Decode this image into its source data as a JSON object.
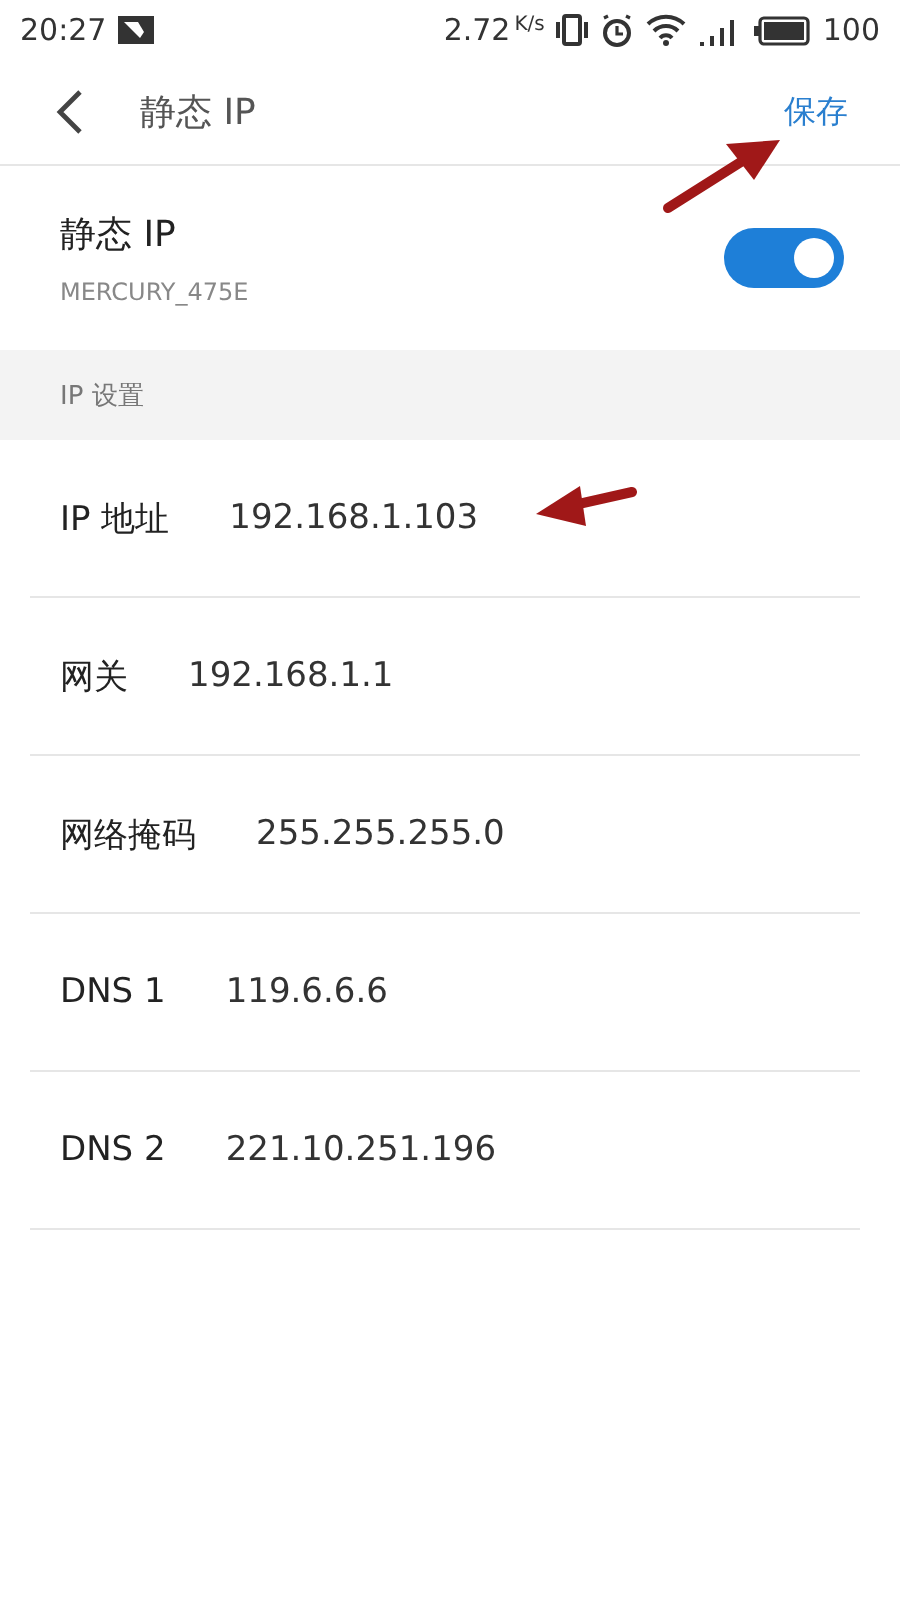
{
  "status_bar": {
    "time": "20:27",
    "speed": "2.72",
    "speed_unit": "K/s",
    "battery": "100"
  },
  "header": {
    "title": "静态 IP",
    "action": "保存"
  },
  "static_ip": {
    "title": "静态 IP",
    "network": "MERCURY_475E",
    "on": true
  },
  "section": {
    "title": "IP 设置"
  },
  "fields": [
    {
      "label": "IP 地址",
      "value": "192.168.1.103"
    },
    {
      "label": "网关",
      "value": "192.168.1.1"
    },
    {
      "label": "网络掩码",
      "value": "255.255.255.0"
    },
    {
      "label": "DNS 1",
      "value": "119.6.6.6"
    },
    {
      "label": "DNS 2",
      "value": "221.10.251.196"
    }
  ]
}
